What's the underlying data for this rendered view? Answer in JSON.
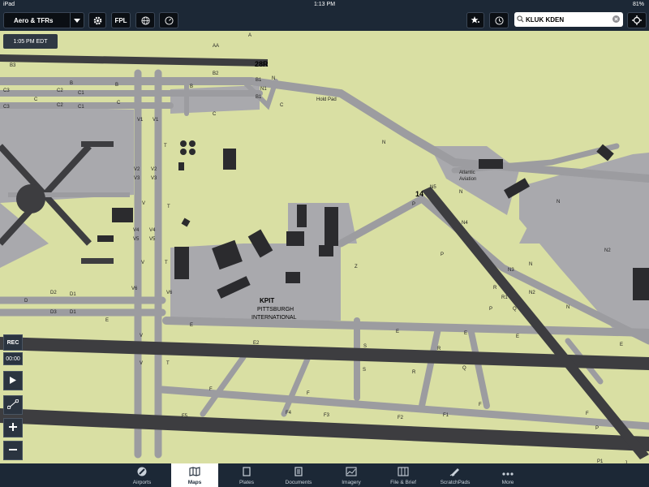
{
  "status_bar": {
    "device": "iPad",
    "time": "1:13 PM",
    "battery": "81%"
  },
  "toolbar": {
    "layer_label": "Aero & TFRs",
    "fpl_label": "FPL",
    "search_value": "KLUK KDEN",
    "icons": [
      "gear-icon",
      "globe-icon",
      "clock-icon",
      "star-icon",
      "history-icon",
      "locate-icon"
    ]
  },
  "map": {
    "time_label": "1:05 PM EDT",
    "airport_id": "KPIT",
    "airport_name_1": "PITTSBURGH",
    "airport_name_2": "INTERNATIONAL",
    "fbo_name_1": "Atlantic",
    "fbo_name_2": "Aviation",
    "runways": [
      "28R",
      "14"
    ],
    "hold_pad": "Hold Pad",
    "taxiway_labels": [
      "A",
      "AA",
      "B",
      "B1",
      "B2",
      "B3",
      "C",
      "C1",
      "C2",
      "C3",
      "D",
      "D1",
      "D2",
      "D3",
      "E",
      "E2",
      "F",
      "F1",
      "F2",
      "F3",
      "F4",
      "F5",
      "J",
      "N",
      "N1",
      "N2",
      "N3",
      "N4",
      "N5",
      "P",
      "P1",
      "Q",
      "R",
      "R1",
      "S",
      "T",
      "V",
      "V1",
      "V2",
      "V3",
      "V4",
      "V5",
      "V6",
      "Z"
    ]
  },
  "side_controls": {
    "rec": "REC",
    "timer": "00:00"
  },
  "tabs": [
    {
      "label": "Airports",
      "icon": "airports-icon",
      "active": false
    },
    {
      "label": "Maps",
      "icon": "maps-icon",
      "active": true
    },
    {
      "label": "Plates",
      "icon": "plates-icon",
      "active": false
    },
    {
      "label": "Documents",
      "icon": "documents-icon",
      "active": false
    },
    {
      "label": "Imagery",
      "icon": "imagery-icon",
      "active": false
    },
    {
      "label": "File & Brief",
      "icon": "file-brief-icon",
      "active": false
    },
    {
      "label": "ScratchPads",
      "icon": "scratchpads-icon",
      "active": false
    },
    {
      "label": "More",
      "icon": "more-icon",
      "active": false
    }
  ],
  "colors": {
    "grass": "#d9dfa3",
    "pavement": "#a9a9ad",
    "runway": "#3d3d40",
    "toolbar": "#1c2836",
    "building": "#2b2b2e"
  }
}
